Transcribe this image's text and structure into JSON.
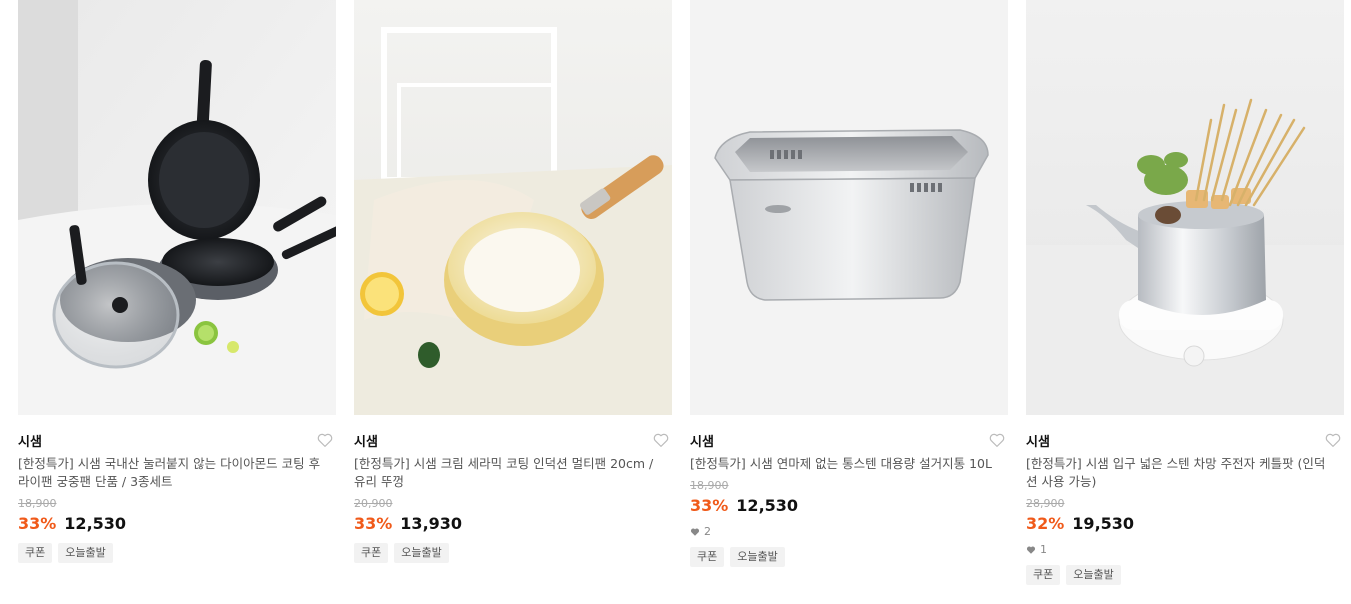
{
  "products": [
    {
      "brand": "시샘",
      "title": "[한정특가] 시샘 국내산 눌러붙지 않는 다이아몬드 코팅 후라이팬 궁중팬 단품 / 3종세트",
      "original_price": "18,900",
      "discount": "33%",
      "price": "12,530",
      "likes": null,
      "badges": [
        "쿠폰",
        "오늘출발"
      ]
    },
    {
      "brand": "시샘",
      "title": "[한정특가] 시샘 크림 세라믹 코팅 인덕션 멀티팬 20cm / 유리 뚜껑",
      "original_price": "20,900",
      "discount": "33%",
      "price": "13,930",
      "likes": null,
      "badges": [
        "쿠폰",
        "오늘출발"
      ]
    },
    {
      "brand": "시샘",
      "title": "[한정특가] 시샘 연마제 없는 통스텐 대용량 설거지통 10L",
      "original_price": "18,900",
      "discount": "33%",
      "price": "12,530",
      "likes": "2",
      "badges": [
        "쿠폰",
        "오늘출발"
      ]
    },
    {
      "brand": "시샘",
      "title": "[한정특가] 시샘 입구 넓은 스텐 차망 주전자 케틀팟 (인덕션 사용 가능)",
      "original_price": "28,900",
      "discount": "32%",
      "price": "19,530",
      "likes": "1",
      "badges": [
        "쿠폰",
        "오늘출발"
      ]
    }
  ],
  "colors": {
    "discount": "#f05a1a",
    "badge_bg": "#f2f2f2",
    "heart": "#bbbbbb"
  },
  "icons": {
    "wishlist": "heart-outline-icon",
    "likes": "heart-filled-icon"
  }
}
